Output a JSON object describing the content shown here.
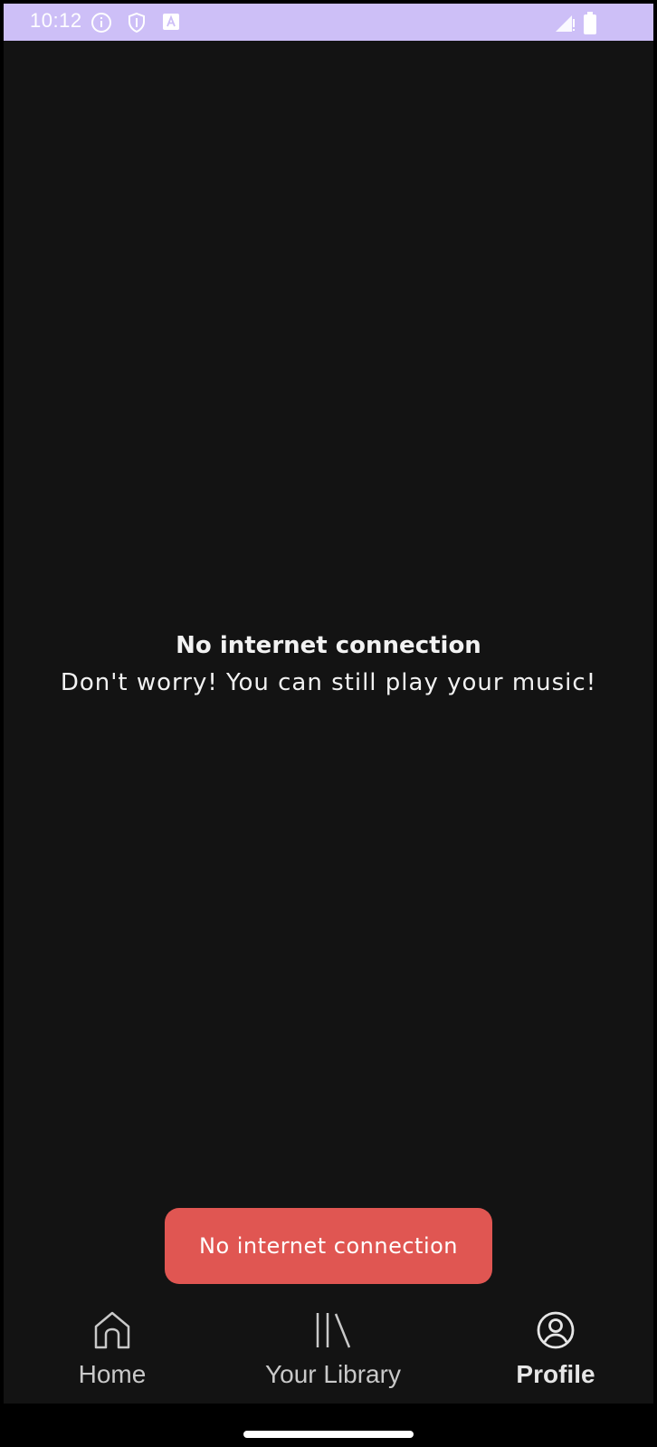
{
  "status_bar": {
    "time": "10:12",
    "icons": [
      "info-icon",
      "shield-icon",
      "accessibility-icon",
      "signal-icon",
      "battery-icon"
    ],
    "background": "#cdbff7"
  },
  "main": {
    "title": "No internet connection",
    "subtitle": "Don't worry! You can still play your music!"
  },
  "toast": {
    "text": "No internet connection",
    "color": "#e05652"
  },
  "bottom_nav": {
    "items": [
      {
        "label": "Home",
        "icon": "home-icon",
        "active": false
      },
      {
        "label": "Your Library",
        "icon": "library-icon",
        "active": false
      },
      {
        "label": "Profile",
        "icon": "profile-icon",
        "active": true
      }
    ]
  }
}
